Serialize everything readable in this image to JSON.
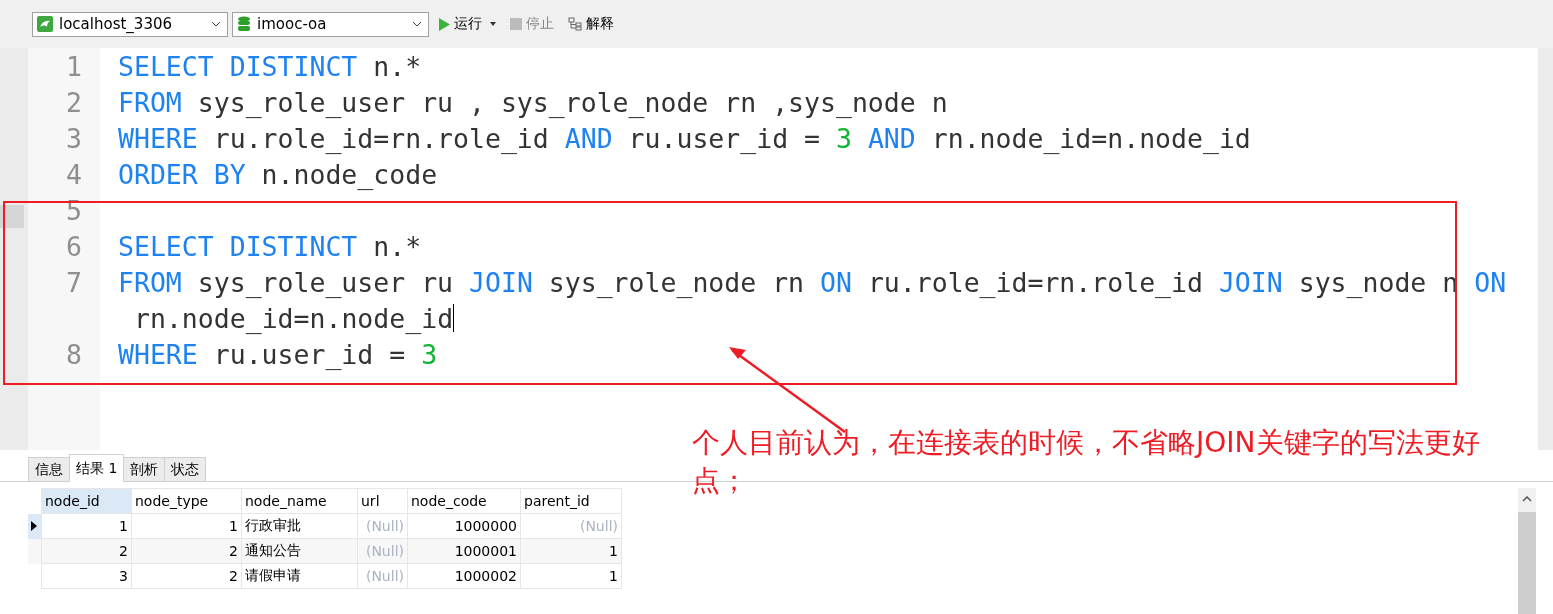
{
  "toolbar": {
    "connection": "localhost_3306",
    "database": "imooc-oa",
    "buttons": [
      {
        "kind": "run",
        "label": "运行",
        "disabled": false
      },
      {
        "kind": "stop",
        "label": "停止",
        "disabled": true
      },
      {
        "kind": "explain",
        "label": "解释",
        "disabled": false
      }
    ]
  },
  "editor": {
    "lines": [
      {
        "number": "1",
        "tokens": [
          {
            "kind": "kw",
            "text": "SELECT DISTINCT"
          },
          {
            "kind": "id",
            "text": " n.*"
          }
        ]
      },
      {
        "number": "2",
        "tokens": [
          {
            "kind": "kw",
            "text": "FROM"
          },
          {
            "kind": "id",
            "text": " sys_role_user ru , sys_role_node rn ,sys_node n"
          }
        ]
      },
      {
        "number": "3",
        "tokens": [
          {
            "kind": "kw",
            "text": "WHERE"
          },
          {
            "kind": "id",
            "text": " ru.role_id=rn.role_id "
          },
          {
            "kind": "kw",
            "text": "AND"
          },
          {
            "kind": "id",
            "text": " ru.user_id = "
          },
          {
            "kind": "num",
            "text": "3"
          },
          {
            "kind": "kw",
            "text": " AND"
          },
          {
            "kind": "id",
            "text": " rn.node_id=n.node_id"
          }
        ]
      },
      {
        "number": "4",
        "tokens": [
          {
            "kind": "kw",
            "text": "ORDER BY"
          },
          {
            "kind": "id",
            "text": " n.node_code"
          }
        ]
      },
      {
        "number": "5"
      },
      {
        "number": "6",
        "tokens": [
          {
            "kind": "kw",
            "text": "SELECT DISTINCT"
          },
          {
            "kind": "id",
            "text": " n.*"
          }
        ]
      },
      {
        "number": "7",
        "tokens": [
          {
            "kind": "kw",
            "text": "FROM"
          },
          {
            "kind": "id",
            "text": " sys_role_user ru "
          },
          {
            "kind": "kw",
            "text": "JOIN"
          },
          {
            "kind": "id",
            "text": " sys_role_node rn "
          },
          {
            "kind": "kw",
            "text": "ON"
          },
          {
            "kind": "id",
            "text": " ru.role_id=rn.role_id "
          },
          {
            "kind": "kw",
            "text": "JOIN"
          },
          {
            "kind": "id",
            "text": " sys_node n "
          },
          {
            "kind": "kw",
            "text": "ON"
          }
        ],
        "wrapped_tokens": [
          {
            "kind": "id",
            "text": "rn.node_id=n.node_id"
          }
        ]
      },
      {
        "number": "8",
        "tokens": [
          {
            "kind": "kw",
            "text": "WHERE"
          },
          {
            "kind": "id",
            "text": " ru.user_id = "
          },
          {
            "kind": "num",
            "text": "3"
          }
        ]
      }
    ]
  },
  "annotation": {
    "text": "个人目前认为，在连接表的时候，不省略JOIN关键字的写法更好点；"
  },
  "results": {
    "tabs": [
      {
        "label": "信息",
        "selected": false
      },
      {
        "label": "结果 1",
        "selected": true
      },
      {
        "label": "剖析",
        "selected": false
      },
      {
        "label": "状态",
        "selected": false
      }
    ],
    "table": {
      "columns": [
        "node_id",
        "node_type",
        "node_name",
        "url",
        "node_code",
        "parent_id"
      ],
      "rows": [
        {
          "current": true,
          "cells": [
            {
              "text": "1",
              "kind": "num"
            },
            {
              "text": "1",
              "kind": "num"
            },
            {
              "text": "行政审批",
              "kind": "text"
            },
            {
              "text": "(Null)",
              "kind": "null"
            },
            {
              "text": "1000000",
              "kind": "num"
            },
            {
              "text": "(Null)",
              "kind": "null"
            }
          ]
        },
        {
          "current": false,
          "cells": [
            {
              "text": "2",
              "kind": "num"
            },
            {
              "text": "2",
              "kind": "num"
            },
            {
              "text": "通知公告",
              "kind": "text"
            },
            {
              "text": "(Null)",
              "kind": "null"
            },
            {
              "text": "1000001",
              "kind": "num"
            },
            {
              "text": "1",
              "kind": "num"
            }
          ]
        },
        {
          "current": false,
          "cells": [
            {
              "text": "3",
              "kind": "num"
            },
            {
              "text": "2",
              "kind": "num"
            },
            {
              "text": "请假申请",
              "kind": "text"
            },
            {
              "text": "(Null)",
              "kind": "null"
            },
            {
              "text": "1000002",
              "kind": "num"
            },
            {
              "text": "1",
              "kind": "num"
            }
          ]
        }
      ]
    }
  }
}
